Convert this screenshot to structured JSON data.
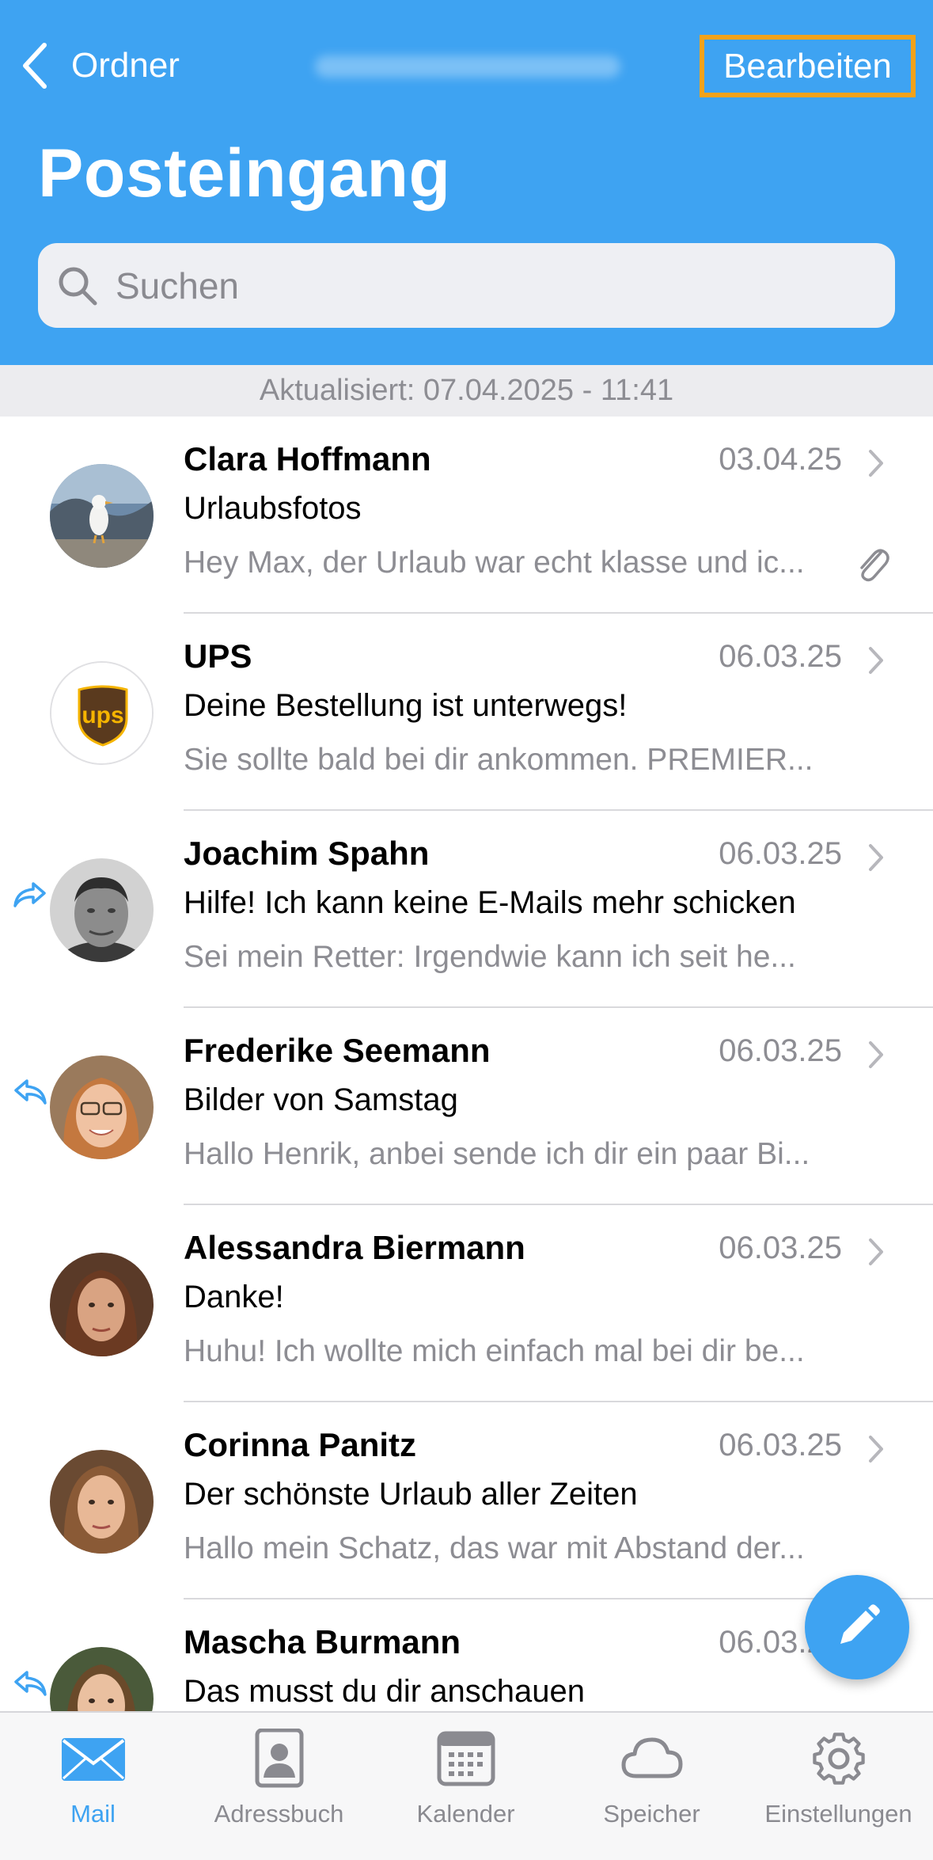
{
  "header": {
    "back_label": "Ordner",
    "edit_label": "Bearbeiten",
    "title": "Posteingang",
    "search_placeholder": "Suchen"
  },
  "updated_text": "Aktualisiert: 07.04.2025 - 11:41",
  "colors": {
    "accent": "#3ea3f2",
    "edit_highlight": "#f2a21a",
    "secondary_text": "#8d8d93"
  },
  "messages": [
    {
      "sender": "Clara Hoffmann",
      "date": "03.04.25",
      "subject": "Urlaubsfotos",
      "preview": "Hey Max, der Urlaub war echt klasse und ic...",
      "status_icon": "",
      "attachment": true,
      "avatar": "seagull-photo"
    },
    {
      "sender": "UPS",
      "date": "06.03.25",
      "subject": "Deine Bestellung ist unterwegs!",
      "preview": "Sie sollte bald bei dir ankommen. PREMIER...",
      "status_icon": "",
      "attachment": false,
      "avatar": "ups-logo"
    },
    {
      "sender": "Joachim Spahn",
      "date": "06.03.25",
      "subject": "Hilfe! Ich kann keine E-Mails mehr schicken",
      "preview": "Sei mein Retter: Irgendwie kann ich seit he...",
      "status_icon": "forwarded-icon",
      "attachment": false,
      "avatar": "person-photo"
    },
    {
      "sender": "Frederike Seemann",
      "date": "06.03.25",
      "subject": "Bilder von Samstag",
      "preview": "Hallo Henrik, anbei sende ich dir ein paar Bi...",
      "status_icon": "replied-icon",
      "attachment": false,
      "avatar": "person-photo"
    },
    {
      "sender": "Alessandra Biermann",
      "date": "06.03.25",
      "subject": "Danke!",
      "preview": "Huhu! Ich wollte mich einfach mal bei dir be...",
      "status_icon": "",
      "attachment": false,
      "avatar": "person-photo"
    },
    {
      "sender": "Corinna Panitz",
      "date": "06.03.25",
      "subject": "Der schönste Urlaub aller Zeiten",
      "preview": "Hallo mein Schatz, das war mit Abstand der...",
      "status_icon": "",
      "attachment": false,
      "avatar": "person-photo"
    },
    {
      "sender": "Mascha Burmann",
      "date": "06.03.25",
      "subject": "Das musst du dir anschauen",
      "preview": "",
      "status_icon": "replied-icon",
      "attachment": false,
      "avatar": "person-photo"
    }
  ],
  "tabs": [
    {
      "label": "Mail",
      "icon": "envelope-icon",
      "active": true
    },
    {
      "label": "Adressbuch",
      "icon": "contact-card-icon",
      "active": false
    },
    {
      "label": "Kalender",
      "icon": "calendar-icon",
      "active": false
    },
    {
      "label": "Speicher",
      "icon": "cloud-icon",
      "active": false
    },
    {
      "label": "Einstellungen",
      "icon": "gear-icon",
      "active": false
    }
  ]
}
